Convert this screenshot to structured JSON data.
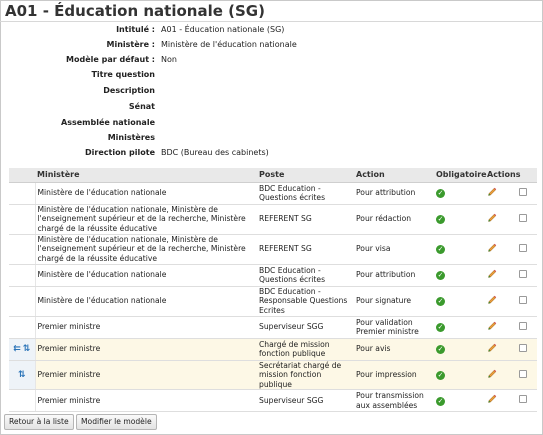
{
  "page": {
    "title": "A01 - Éducation nationale (SG)"
  },
  "fields": [
    {
      "label": "Intitulé :",
      "value": "A01 - Éducation nationale (SG)"
    },
    {
      "label": "Ministère :",
      "value": "Ministère de l'éducation nationale"
    },
    {
      "label": "Modèle par défaut :",
      "value": "Non"
    },
    {
      "label": "Titre question",
      "value": ""
    },
    {
      "label": "Description",
      "value": ""
    },
    {
      "label": "Sénat",
      "value": ""
    },
    {
      "label": "Assemblée nationale",
      "value": ""
    },
    {
      "label": "Ministères",
      "value": ""
    },
    {
      "label": "Direction pilote",
      "value": "BDC (Bureau des cabinets)"
    }
  ],
  "table": {
    "headers": {
      "ministere": "Ministère",
      "poste": "Poste",
      "action": "Action",
      "obligatoire": "Obligatoire",
      "actions": "Actions"
    },
    "rows": [
      {
        "ministere": "Ministère de l'éducation nationale",
        "poste": "BDC Education - Questions écrites",
        "action": "Pour attribution",
        "obligatoire": true,
        "highlighted": false,
        "handles": []
      },
      {
        "ministere": "Ministère de l'éducation nationale, Ministère de l'enseignement supérieur et de la recherche, Ministère chargé de la réussite éducative",
        "poste": "REFERENT SG",
        "action": "Pour rédaction",
        "obligatoire": true,
        "highlighted": false,
        "handles": []
      },
      {
        "ministere": "Ministère de l'éducation nationale, Ministère de l'enseignement supérieur et de la recherche, Ministère chargé de la réussite éducative",
        "poste": "REFERENT SG",
        "action": "Pour visa",
        "obligatoire": true,
        "highlighted": false,
        "handles": []
      },
      {
        "ministere": "Ministère de l'éducation nationale",
        "poste": "BDC Education - Questions écrites",
        "action": "Pour attribution",
        "obligatoire": true,
        "highlighted": false,
        "handles": []
      },
      {
        "ministere": "Ministère de l'éducation nationale",
        "poste": "BDC Education - Responsable Questions Ecrites",
        "action": "Pour signature",
        "obligatoire": true,
        "highlighted": false,
        "handles": []
      },
      {
        "ministere": "Premier ministre",
        "poste": "Superviseur SGG",
        "action": "Pour validation Premier ministre",
        "obligatoire": true,
        "highlighted": false,
        "handles": []
      },
      {
        "ministere": "Premier ministre",
        "poste": "Chargé de mission fonction publique",
        "action": "Pour avis",
        "obligatoire": true,
        "highlighted": true,
        "handles": [
          "parallel-icon",
          "move-updown-icon"
        ]
      },
      {
        "ministere": "Premier ministre",
        "poste": "Secrétariat chargé de mission fonction publique",
        "action": "Pour impression",
        "obligatoire": true,
        "highlighted": true,
        "handles": [
          "move-updown-icon"
        ]
      },
      {
        "ministere": "Premier ministre",
        "poste": "Superviseur SGG",
        "action": "Pour transmission aux assemblées",
        "obligatoire": true,
        "highlighted": false,
        "handles": []
      }
    ]
  },
  "buttons": {
    "back": "Retour à la liste",
    "edit": "Modifier le modèle"
  },
  "colors": {
    "highlight_row": "#fdf8e6",
    "check_green": "#3b9a2d",
    "sort_blue": "#2b74b8"
  }
}
